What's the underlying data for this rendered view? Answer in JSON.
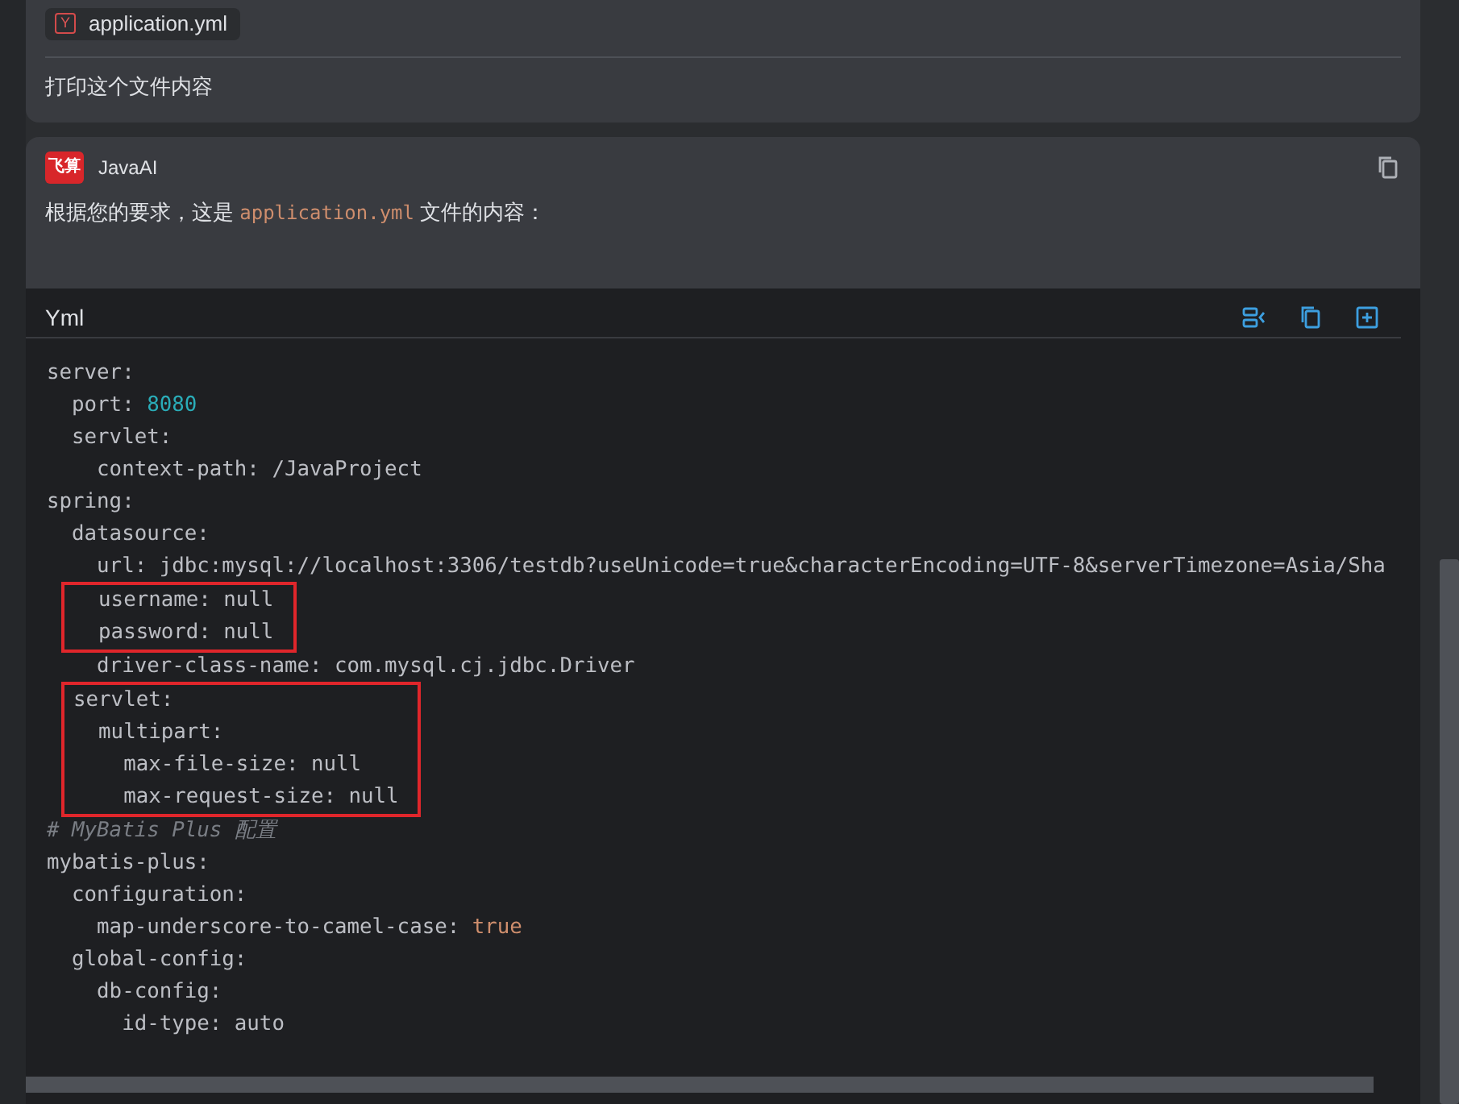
{
  "user_message": {
    "attachment": {
      "badge": "Y",
      "filename": "application.yml"
    },
    "text": "打印这个文件内容"
  },
  "reply": {
    "logo": "飞算",
    "author": "JavaAI",
    "intro": [
      {
        "kind": "text",
        "text": "根据您的要求，这是 "
      },
      {
        "kind": "code",
        "text": "application.yml"
      },
      {
        "kind": "text",
        "text": " 文件的内容："
      }
    ],
    "code": {
      "language": "Yml",
      "blocks": [
        {
          "boxed": false,
          "lines": [
            [
              {
                "kind": "key",
                "text": "server:"
              }
            ],
            [
              {
                "kind": "key",
                "text": "  port: "
              },
              {
                "kind": "number",
                "text": "8080"
              }
            ],
            [
              {
                "kind": "key",
                "text": "  servlet:"
              }
            ],
            [
              {
                "kind": "key",
                "text": "    context-path: /JavaProject"
              }
            ],
            [
              {
                "kind": "key",
                "text": "spring:"
              }
            ],
            [
              {
                "kind": "key",
                "text": "  datasource:"
              }
            ],
            [
              {
                "kind": "key",
                "text": "    url: jdbc:mysql://localhost:3306/testdb?useUnicode=true&characterEncoding=UTF-8&serverTimezone=Asia/Sha"
              }
            ]
          ]
        },
        {
          "boxed": true,
          "lines": [
            [
              {
                "kind": "key",
                "text": "    username: null"
              }
            ],
            [
              {
                "kind": "key",
                "text": "    password: null"
              }
            ]
          ]
        },
        {
          "boxed": false,
          "lines": [
            [
              {
                "kind": "key",
                "text": "    driver-class-name: com.mysql.cj.jdbc.Driver"
              }
            ]
          ]
        },
        {
          "boxed": true,
          "lines": [
            [
              {
                "kind": "key",
                "text": "  servlet:"
              }
            ],
            [
              {
                "kind": "key",
                "text": "    multipart:"
              }
            ],
            [
              {
                "kind": "key",
                "text": "      max-file-size: null"
              }
            ],
            [
              {
                "kind": "key",
                "text": "      max-request-size: null"
              }
            ]
          ]
        },
        {
          "boxed": false,
          "lines": [
            [
              {
                "kind": "comment",
                "text": "# MyBatis Plus 配置"
              }
            ],
            [
              {
                "kind": "key",
                "text": "mybatis-plus:"
              }
            ],
            [
              {
                "kind": "key",
                "text": "  configuration:"
              }
            ],
            [
              {
                "kind": "key",
                "text": "    map-underscore-to-camel-case: "
              },
              {
                "kind": "keyword",
                "text": "true"
              }
            ],
            [
              {
                "kind": "key",
                "text": "  global-config:"
              }
            ],
            [
              {
                "kind": "key",
                "text": "    db-config:"
              }
            ],
            [
              {
                "kind": "key",
                "text": "      id-type: auto"
              }
            ]
          ]
        }
      ]
    }
  }
}
